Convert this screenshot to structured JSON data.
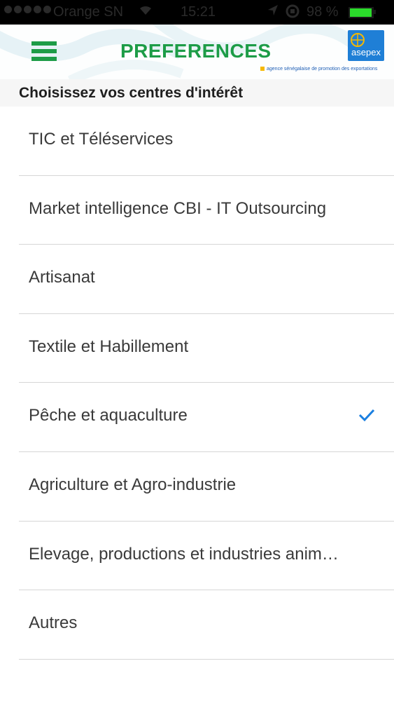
{
  "status_bar": {
    "carrier": "Orange SN",
    "time": "15:21",
    "battery_percent": "98 %",
    "battery_level": 0.98
  },
  "header": {
    "title": "PREFERENCES",
    "logo_text": "asepex",
    "logo_tagline": "agence sénégalaise de promotion des exportations"
  },
  "section": {
    "title": "Choisissez vos centres d'intérêt"
  },
  "interests": [
    {
      "label": "TIC et Téléservices",
      "selected": false
    },
    {
      "label": "Market intelligence CBI - IT Outsourcing",
      "selected": false
    },
    {
      "label": "Artisanat",
      "selected": false
    },
    {
      "label": "Textile et Habillement",
      "selected": false
    },
    {
      "label": "Pêche et aquaculture",
      "selected": true
    },
    {
      "label": "Agriculture et Agro-industrie",
      "selected": false
    },
    {
      "label": "Elevage, productions et industries animales",
      "selected": false
    },
    {
      "label": "Autres",
      "selected": false
    }
  ],
  "colors": {
    "accent_green": "#1d9c47",
    "check_blue": "#1a7fe0",
    "logo_blue": "#1f7fd6"
  }
}
